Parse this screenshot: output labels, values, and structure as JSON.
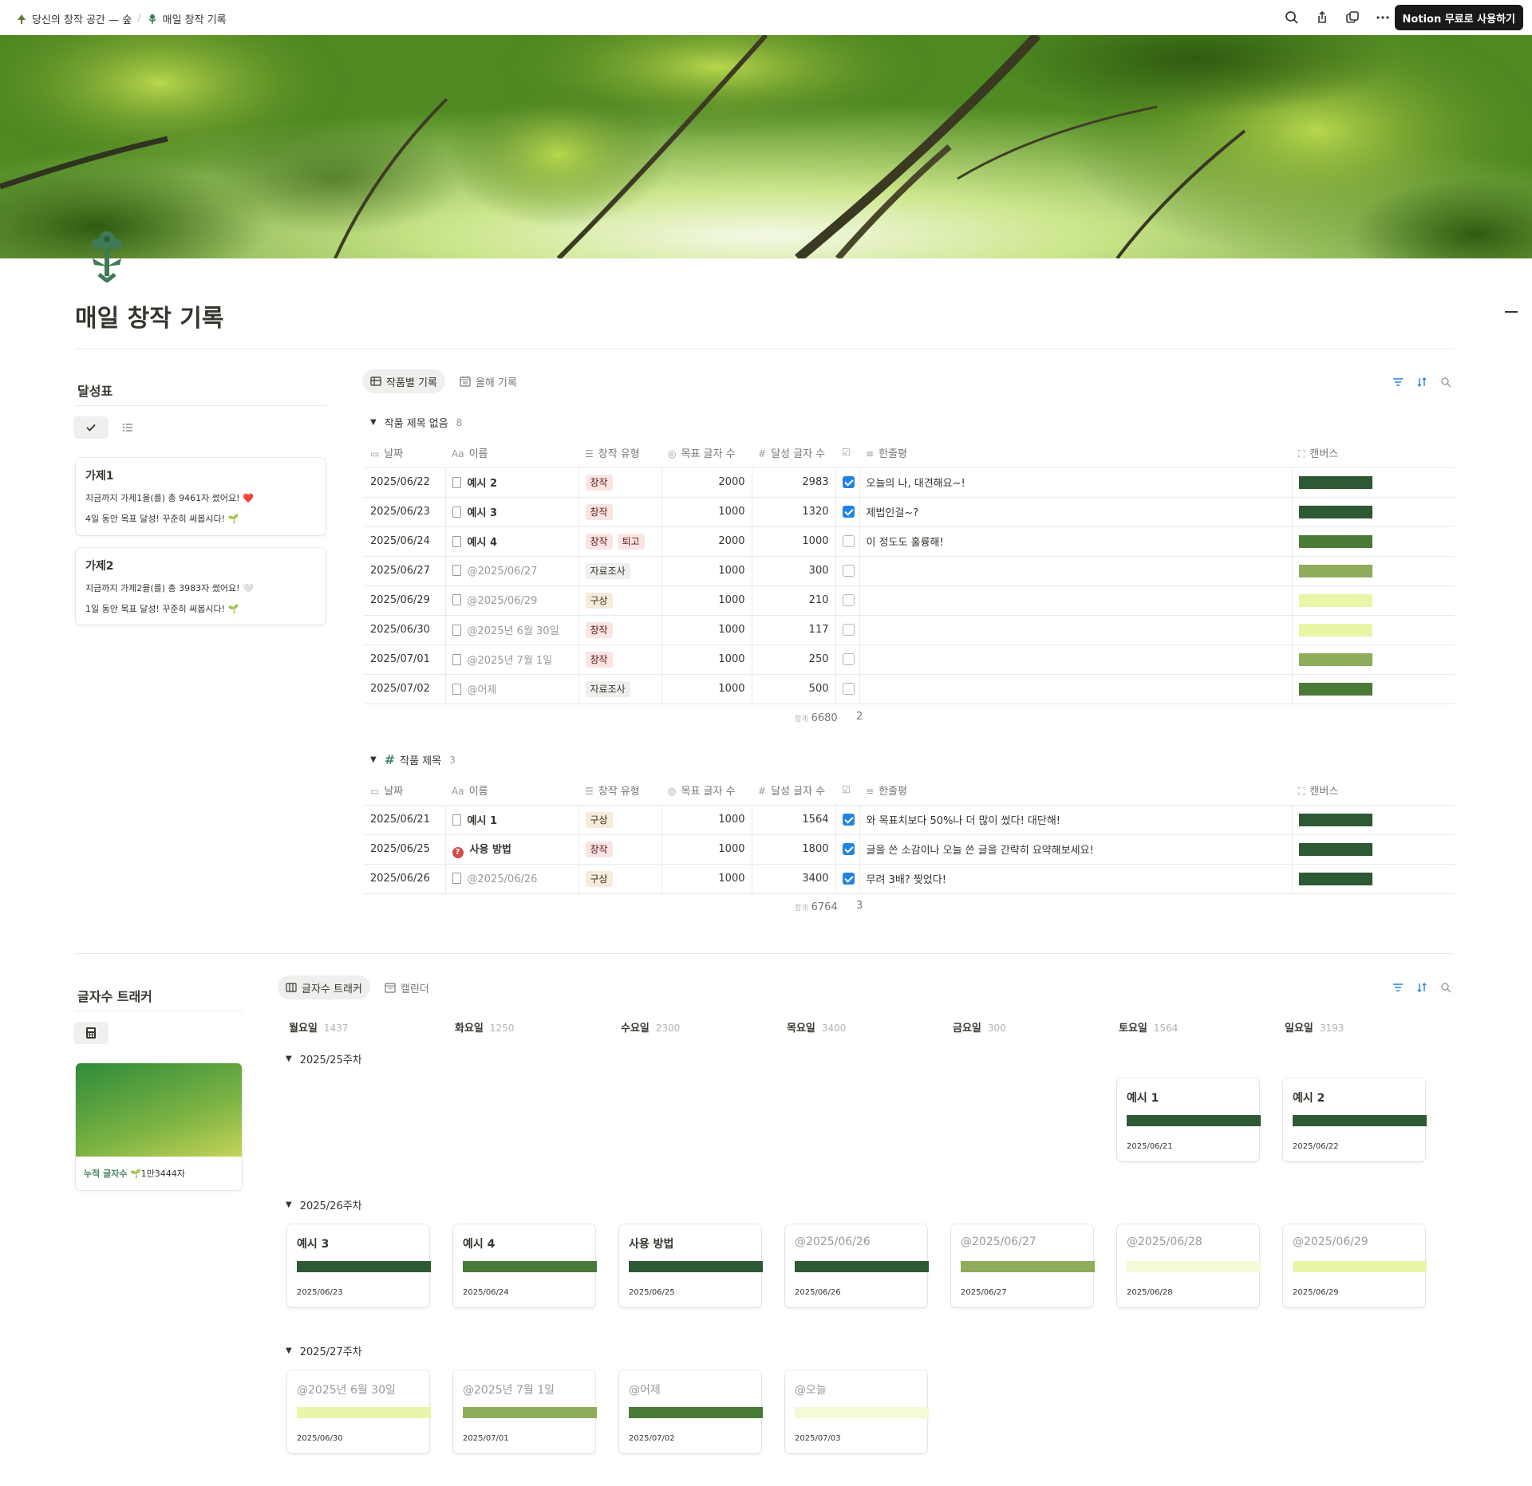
{
  "breadcrumb": [
    "당신의 창작 공간 — 숲",
    "매일 창작 기록"
  ],
  "top_button": "Notion 무료로 사용하기",
  "page_title": "매일 창작 기록",
  "colors": {
    "dark": "#2d5934",
    "medium": "#4a7a37",
    "olive": "#8fac5b",
    "light": "#e9f5a7",
    "pale": "#f3fad6",
    "accent": "#2383e2"
  },
  "achievement": {
    "title": "달성표",
    "cards": [
      {
        "title": "가제1",
        "line1": "지금까지 가제1을(를) 총 9461자 썼어요! ❤️",
        "line2": "4일 동안 목표 달성! 꾸준히 써봅시다! 🌱"
      },
      {
        "title": "가제2",
        "line1": "지금까지 가제2을(를) 총 3983자 썼어요! 🤍",
        "line2": "1일 동안 목표 달성! 꾸준히 써봅시다! 🌱"
      }
    ]
  },
  "db": {
    "tabs": [
      "작품별 기록",
      "올해 기록"
    ],
    "columns": [
      "날짜",
      "이름",
      "창작 유형",
      "목표 글자 수",
      "달성 글자 수",
      "",
      "한줄평",
      "캔버스"
    ],
    "groups": [
      {
        "name": "작품 제목 없음",
        "count": "8",
        "sum_label": "합계",
        "sum": "6680",
        "checked_count": "2",
        "rows": [
          {
            "date": "2025/06/22",
            "name": "예시 2",
            "mention": false,
            "tags": [
              "창작"
            ],
            "goal": "2000",
            "done": "2983",
            "check": true,
            "review": "오늘의 나, 대견해요~!",
            "bar": "dark"
          },
          {
            "date": "2025/06/23",
            "name": "예시 3",
            "mention": false,
            "tags": [
              "창작"
            ],
            "goal": "1000",
            "done": "1320",
            "check": true,
            "review": "제법인걸~?",
            "bar": "dark"
          },
          {
            "date": "2025/06/24",
            "name": "예시 4",
            "mention": false,
            "tags": [
              "창작",
              "퇴고"
            ],
            "goal": "2000",
            "done": "1000",
            "check": false,
            "review": "이 정도도 훌륭해!",
            "bar": "medium"
          },
          {
            "date": "2025/06/27",
            "name": "@2025/06/27",
            "mention": true,
            "tags": [
              "자료조사"
            ],
            "goal": "1000",
            "done": "300",
            "check": false,
            "review": "",
            "bar": "olive"
          },
          {
            "date": "2025/06/29",
            "name": "@2025/06/29",
            "mention": true,
            "tags": [
              "구상"
            ],
            "goal": "1000",
            "done": "210",
            "check": false,
            "review": "",
            "bar": "light"
          },
          {
            "date": "2025/06/30",
            "name": "@2025년 6월 30일",
            "mention": true,
            "tags": [
              "창작"
            ],
            "goal": "1000",
            "done": "117",
            "check": false,
            "review": "",
            "bar": "light"
          },
          {
            "date": "2025/07/01",
            "name": "@2025년 7월 1일",
            "mention": true,
            "tags": [
              "창작"
            ],
            "goal": "1000",
            "done": "250",
            "check": false,
            "review": "",
            "bar": "olive"
          },
          {
            "date": "2025/07/02",
            "name": "@어제",
            "mention": true,
            "tags": [
              "자료조사"
            ],
            "goal": "1000",
            "done": "500",
            "check": false,
            "review": "",
            "bar": "medium"
          }
        ]
      },
      {
        "name": "작품 제목",
        "count": "3",
        "sum_label": "합계",
        "sum": "6764",
        "checked_count": "3",
        "rows": [
          {
            "date": "2025/06/21",
            "name": "예시 1",
            "mention": false,
            "icon": "doc",
            "tags": [
              "구상"
            ],
            "goal": "1000",
            "done": "1564",
            "check": true,
            "review": "와 목표치보다 50%나 더 많이 썼다! 대단해!",
            "bar": "dark"
          },
          {
            "date": "2025/06/25",
            "name": "사용 방법",
            "mention": false,
            "icon": "question",
            "tags": [
              "창작"
            ],
            "goal": "1000",
            "done": "1800",
            "check": true,
            "review": "글을 쓴 소감이나 오늘 쓴 글을 간략히 요약해보세요!",
            "bar": "dark"
          },
          {
            "date": "2025/06/26",
            "name": "@2025/06/26",
            "mention": true,
            "icon": "doc",
            "tags": [
              "구상"
            ],
            "goal": "1000",
            "done": "3400",
            "check": true,
            "review": "무려 3배? 찢었다!",
            "bar": "dark"
          }
        ]
      }
    ]
  },
  "tracker": {
    "title": "글자수 트래커",
    "gallery_caption_label": "누적 글자수",
    "gallery_caption_value": "🌱1만3444자",
    "tabs": [
      "글자수 트래커",
      "캘린더"
    ],
    "days": [
      {
        "name": "월요일",
        "count": "1437"
      },
      {
        "name": "화요일",
        "count": "1250"
      },
      {
        "name": "수요일",
        "count": "2300"
      },
      {
        "name": "목요일",
        "count": "3400"
      },
      {
        "name": "금요일",
        "count": "300"
      },
      {
        "name": "토요일",
        "count": "1564"
      },
      {
        "name": "일요일",
        "count": "3193"
      }
    ],
    "weeks": [
      {
        "name": "2025/25주차",
        "cards": [
          {
            "col": 5,
            "title": "예시 1",
            "mention": false,
            "bar": "dark",
            "date": "2025/06/21"
          },
          {
            "col": 6,
            "title": "예시 2",
            "mention": false,
            "bar": "dark",
            "date": "2025/06/22"
          }
        ]
      },
      {
        "name": "2025/26주차",
        "cards": [
          {
            "col": 0,
            "title": "예시 3",
            "mention": false,
            "bar": "dark",
            "date": "2025/06/23"
          },
          {
            "col": 1,
            "title": "예시 4",
            "mention": false,
            "bar": "medium",
            "date": "2025/06/24"
          },
          {
            "col": 2,
            "title": "사용 방법",
            "mention": false,
            "bar": "dark",
            "date": "2025/06/25"
          },
          {
            "col": 3,
            "title": "@2025/06/26",
            "mention": true,
            "bar": "dark",
            "date": "2025/06/26"
          },
          {
            "col": 4,
            "title": "@2025/06/27",
            "mention": true,
            "bar": "olive",
            "date": "2025/06/27"
          },
          {
            "col": 5,
            "title": "@2025/06/28",
            "mention": true,
            "bar": "pale",
            "date": "2025/06/28"
          },
          {
            "col": 6,
            "title": "@2025/06/29",
            "mention": true,
            "bar": "light",
            "date": "2025/06/29"
          }
        ]
      },
      {
        "name": "2025/27주차",
        "cards": [
          {
            "col": 0,
            "title": "@2025년 6월 30일",
            "mention": true,
            "bar": "light",
            "date": "2025/06/30"
          },
          {
            "col": 1,
            "title": "@2025년 7월 1일",
            "mention": true,
            "bar": "olive",
            "date": "2025/07/01"
          },
          {
            "col": 2,
            "title": "@어제",
            "mention": true,
            "bar": "medium",
            "date": "2025/07/02"
          },
          {
            "col": 3,
            "title": "@오늘",
            "mention": true,
            "bar": "pale",
            "date": "2025/07/03"
          }
        ]
      }
    ]
  }
}
